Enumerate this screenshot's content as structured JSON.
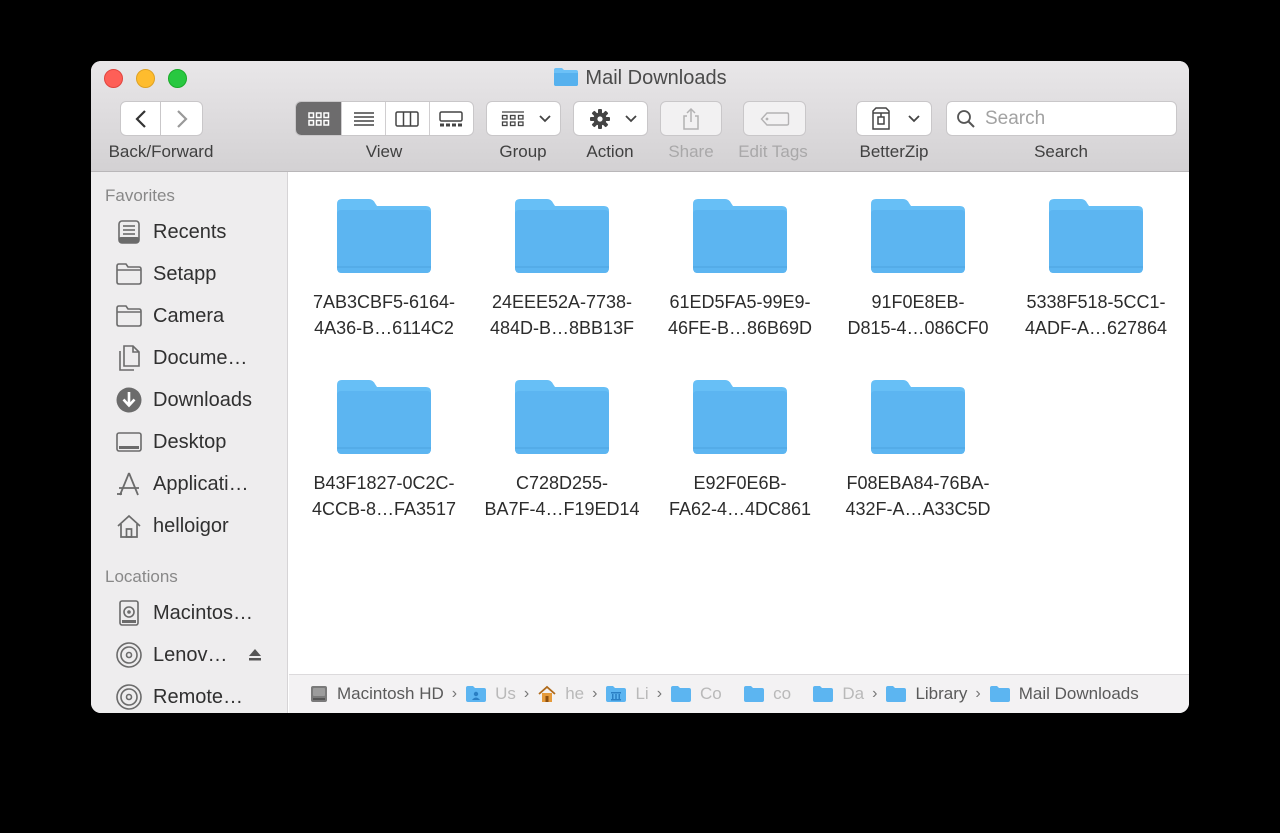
{
  "window": {
    "title": "Mail Downloads"
  },
  "toolbar": {
    "back_forward_label": "Back/Forward",
    "view_label": "View",
    "group_label": "Group",
    "action_label": "Action",
    "share_label": "Share",
    "edit_tags_label": "Edit Tags",
    "betterzip_label": "BetterZip",
    "search_label": "Search",
    "search_placeholder": "Search",
    "active_view": "icon"
  },
  "sidebar": {
    "favorites_header": "Favorites",
    "favorites": [
      {
        "label": "Recents",
        "icon": "recents-icon"
      },
      {
        "label": "Setapp",
        "icon": "folder-icon"
      },
      {
        "label": "Camera",
        "icon": "folder-icon"
      },
      {
        "label": "Docume…",
        "icon": "document-icon"
      },
      {
        "label": "Downloads",
        "icon": "downloads-icon"
      },
      {
        "label": "Desktop",
        "icon": "desktop-icon"
      },
      {
        "label": "Applicati…",
        "icon": "applications-icon"
      },
      {
        "label": "helloigor",
        "icon": "home-icon"
      }
    ],
    "locations_header": "Locations",
    "locations": [
      {
        "label": "Macintos…",
        "icon": "hard-drive-icon"
      },
      {
        "label": "Lenov…",
        "icon": "disc-icon",
        "eject": true
      },
      {
        "label": "Remote…",
        "icon": "disc-icon"
      }
    ]
  },
  "files": [
    {
      "line1": "7AB3CBF5-6164-",
      "line2": "4A36-B…6114C2"
    },
    {
      "line1": "24EEE52A-7738-",
      "line2": "484D-B…8BB13F"
    },
    {
      "line1": "61ED5FA5-99E9-",
      "line2": "46FE-B…86B69D"
    },
    {
      "line1": "91F0E8EB-",
      "line2": "D815-4…086CF0"
    },
    {
      "line1": "5338F518-5CC1-",
      "line2": "4ADF-A…627864"
    },
    {
      "line1": "B43F1827-0C2C-",
      "line2": "4CCB-8…FA3517"
    },
    {
      "line1": "C728D255-",
      "line2": "BA7F-4…F19ED14"
    },
    {
      "line1": "E92F0E6B-",
      "line2": "FA62-4…4DC861"
    },
    {
      "line1": "F08EBA84-76BA-",
      "line2": "432F-A…A33C5D"
    }
  ],
  "path": [
    {
      "label": "Macintosh HD",
      "icon": "hard-drive-icon"
    },
    {
      "label": "Us",
      "icon": "users-folder-icon"
    },
    {
      "label": "he",
      "icon": "home-icon"
    },
    {
      "label": "Li",
      "icon": "library-folder-icon"
    },
    {
      "label": "Co",
      "icon": "folder-icon"
    },
    {
      "label": "co",
      "icon": "folder-icon"
    },
    {
      "label": "Da",
      "icon": "folder-icon"
    },
    {
      "label": "Library",
      "icon": "folder-icon"
    },
    {
      "label": "Mail Downloads",
      "icon": "folder-icon"
    }
  ],
  "colors": {
    "folder": "#5cb5f1",
    "folder_tab": "#67bff6",
    "close": "#fe5f57",
    "minimize": "#febc2e",
    "zoom": "#28c840"
  }
}
